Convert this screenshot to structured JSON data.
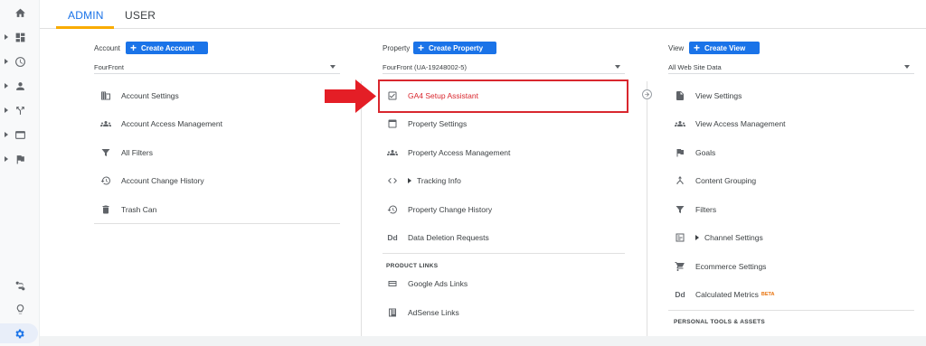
{
  "tabs": {
    "admin": "ADMIN",
    "user": "USER"
  },
  "account": {
    "label": "Account",
    "create_button": "Create Account",
    "selected": "FourFront",
    "items": [
      {
        "label": "Account Settings",
        "icon": "building-icon"
      },
      {
        "label": "Account Access Management",
        "icon": "people-icon"
      },
      {
        "label": "All Filters",
        "icon": "filter-icon"
      },
      {
        "label": "Account Change History",
        "icon": "history-icon"
      },
      {
        "label": "Trash Can",
        "icon": "trash-icon"
      }
    ]
  },
  "property": {
    "label": "Property",
    "create_button": "Create Property",
    "selected": "FourFront (UA-19248002-5)",
    "items": [
      {
        "label": "GA4 Setup Assistant",
        "icon": "checkbox-icon"
      },
      {
        "label": "Property Settings",
        "icon": "window-icon"
      },
      {
        "label": "Property Access Management",
        "icon": "people-icon"
      },
      {
        "label": "Tracking Info",
        "icon": "code-icon"
      },
      {
        "label": "Property Change History",
        "icon": "history-icon"
      },
      {
        "label": "Data Deletion Requests",
        "icon": "dd-icon",
        "glyph": "Dd"
      }
    ],
    "section_title": "PRODUCT LINKS",
    "product_links": [
      {
        "label": "Google Ads Links",
        "icon": "ads-icon"
      },
      {
        "label": "AdSense Links",
        "icon": "adsense-icon"
      }
    ]
  },
  "view": {
    "label": "View",
    "create_button": "Create View",
    "selected": "All Web Site Data",
    "items": [
      {
        "label": "View Settings",
        "icon": "document-icon"
      },
      {
        "label": "View Access Management",
        "icon": "people-icon"
      },
      {
        "label": "Goals",
        "icon": "flag-icon"
      },
      {
        "label": "Content Grouping",
        "icon": "grouping-icon"
      },
      {
        "label": "Filters",
        "icon": "filter-icon"
      },
      {
        "label": "Channel Settings",
        "icon": "channel-icon"
      },
      {
        "label": "Ecommerce Settings",
        "icon": "cart-icon"
      },
      {
        "label": "Calculated Metrics",
        "icon": "dd-icon",
        "glyph": "Dd",
        "badge": "BETA"
      }
    ],
    "section_title": "PERSONAL TOOLS & ASSETS"
  },
  "colors": {
    "accent": "#1a73e8",
    "tab_underline": "#f9ab00",
    "highlight": "#d9272e"
  }
}
